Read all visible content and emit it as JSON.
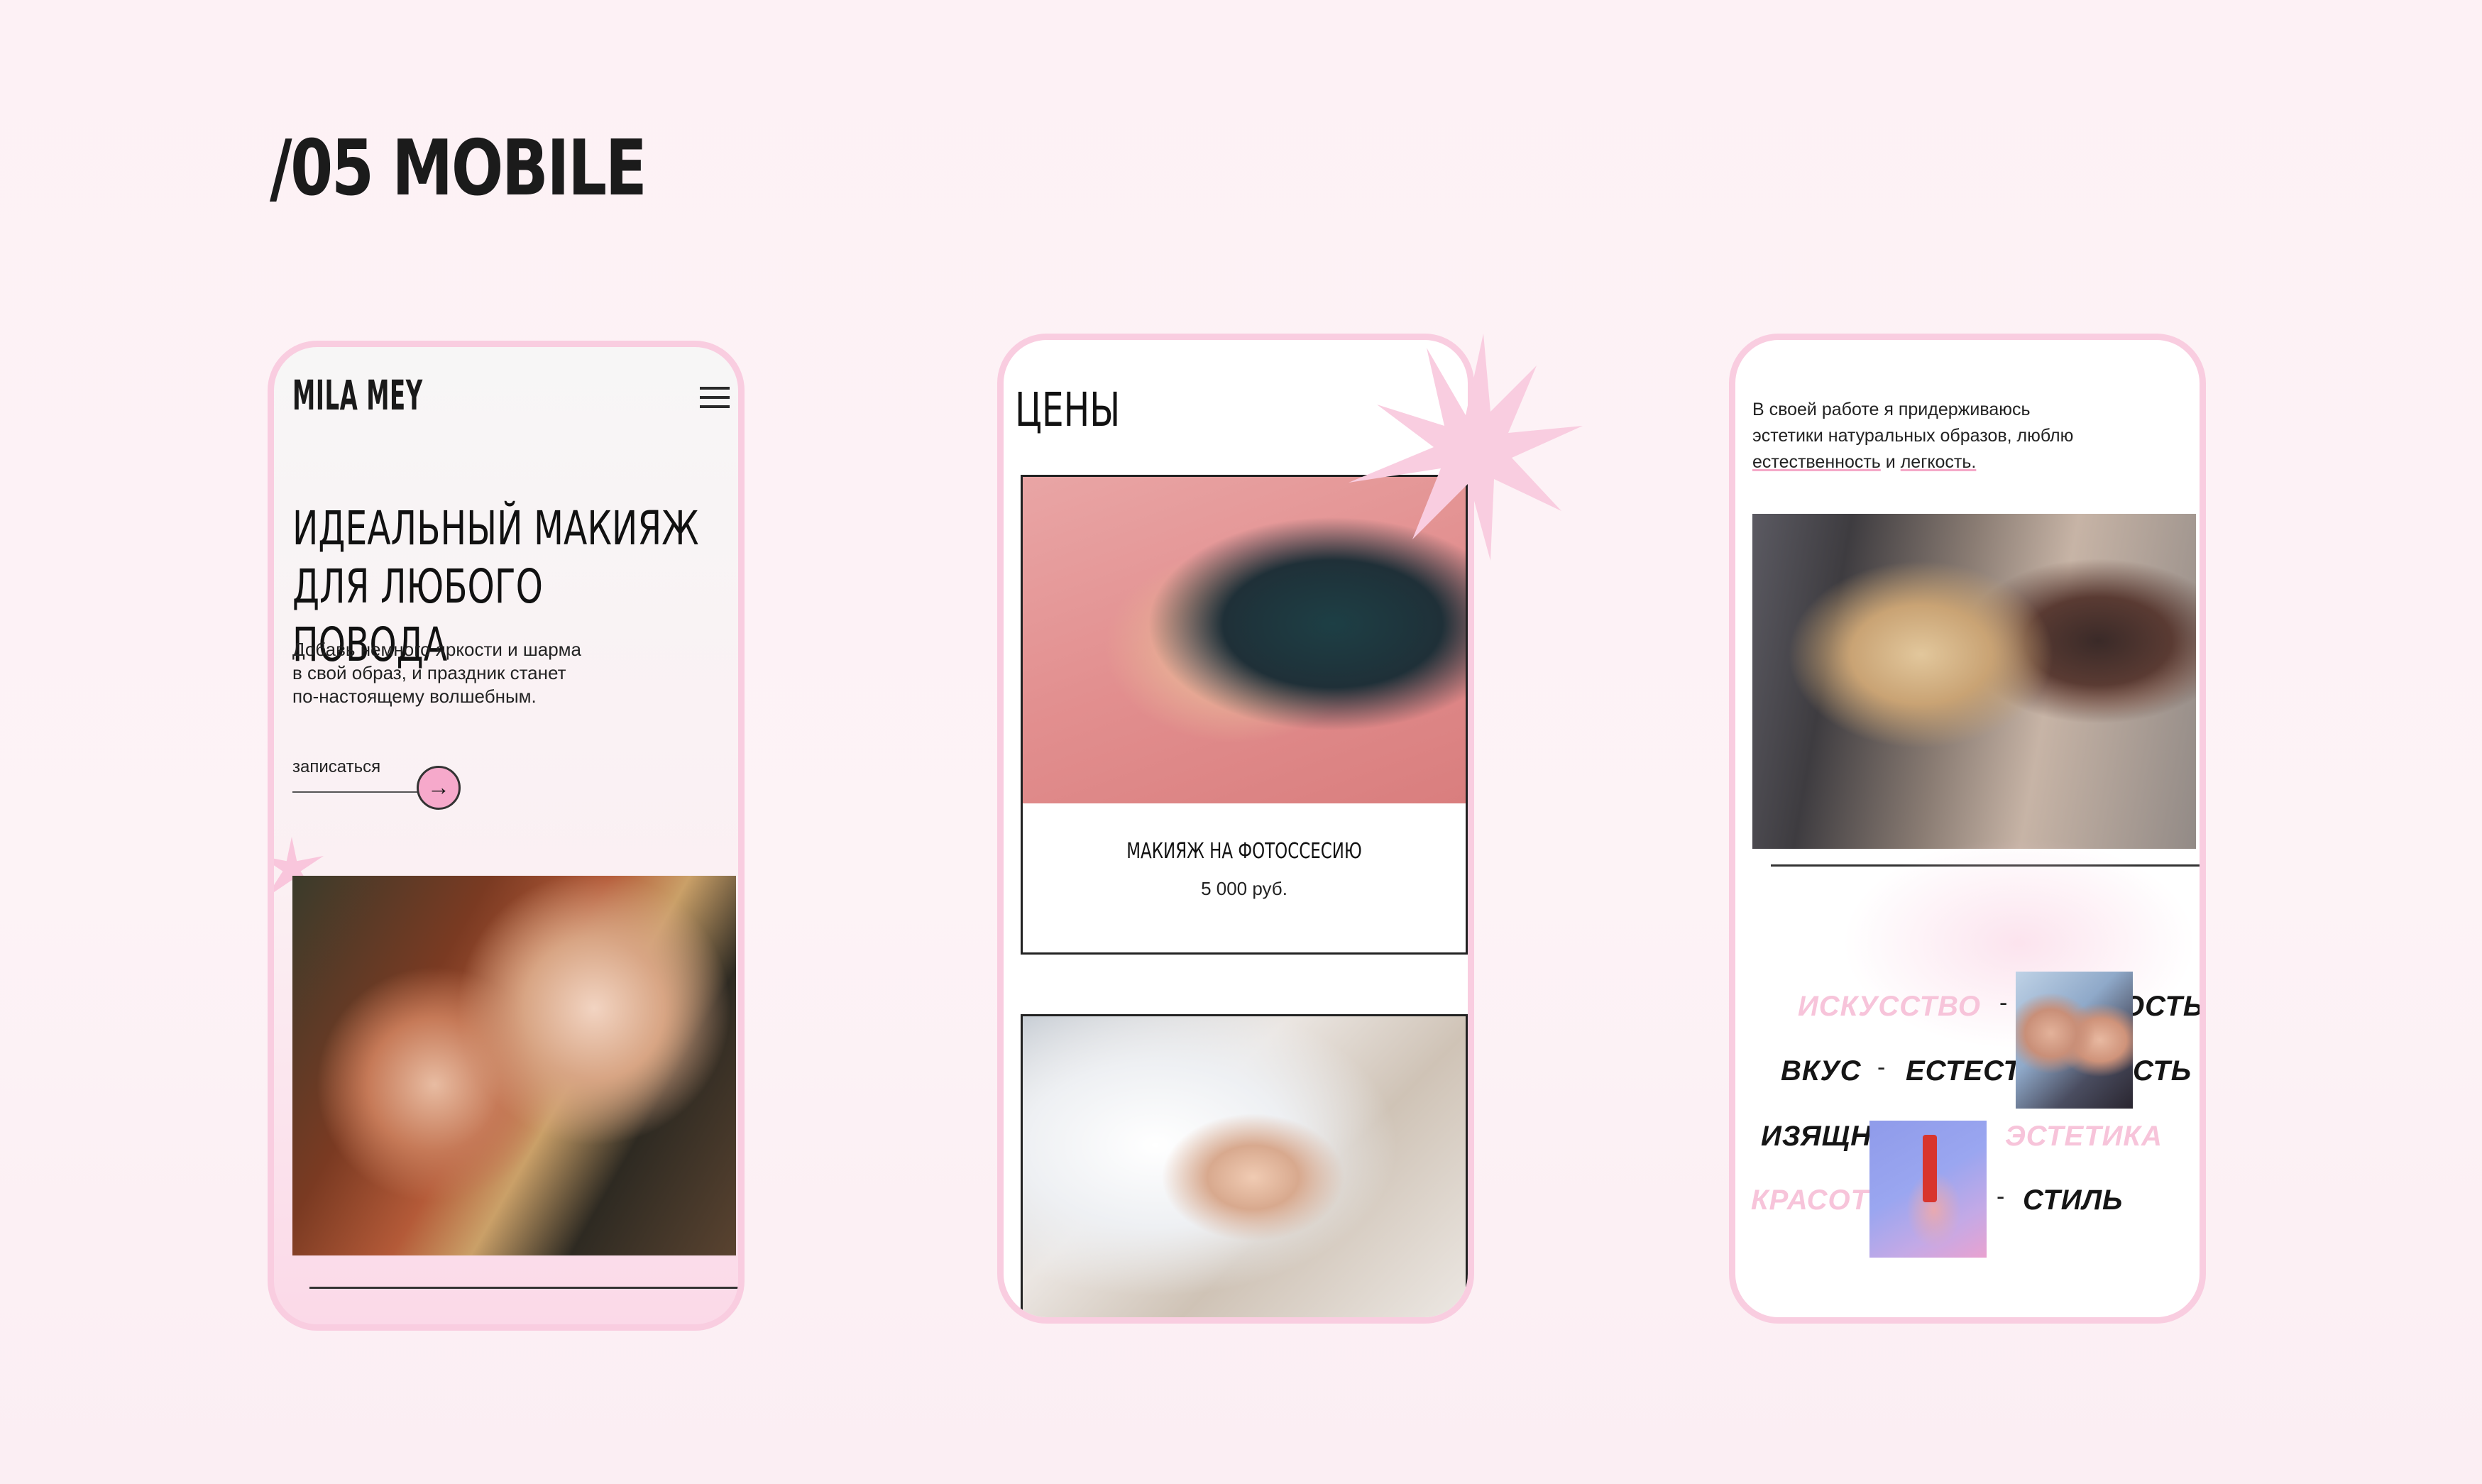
{
  "section": {
    "title": "/05 MOBILE"
  },
  "phone1": {
    "logo": "MILA MEY",
    "menu_icon": "hamburger-menu-icon",
    "hero_title_line1": "ИДЕАЛЬНЫЙ МАКИЯЖ",
    "hero_title_line2": "ДЛЯ ЛЮБОГО ПОВОДА",
    "hero_subtitle_line1": "Добавь немного яркости и шарма",
    "hero_subtitle_line2": "в свой образ, и праздник станет",
    "hero_subtitle_line3": "по-настоящему волшебным.",
    "cta_label": "записаться",
    "cta_icon": "arrow-right-icon",
    "photo": "two-women-portrait"
  },
  "phone2": {
    "title": "ЦЕНЫ",
    "card1": {
      "title": "МАКИЯЖ НА ФОТОССЕСИЮ",
      "price": "5 000 руб.",
      "photo": "woman-profile-makeup"
    },
    "card2": {
      "photo": "bride-with-veil"
    }
  },
  "phone3": {
    "about_line1": "В своей работе я придерживаюсь",
    "about_line2": "эстетики натуральных образов, люблю",
    "about_highlight1": "естественность",
    "about_and": "и",
    "about_highlight2": "легкость.",
    "photo": "makeup-artist-at-work",
    "words": {
      "w1": "ИСКУССТВО",
      "w2": "ОСТЬ",
      "w3": "ВКУС",
      "w4": "ЕСТЕСТ",
      "w5": "СТЬ",
      "w6": "ИЗЯЩН",
      "w7": "ЭСТЕТИКА",
      "w8": "КРАСОТ",
      "w9": "СТИЛЬ"
    },
    "dash": "-"
  },
  "colors": {
    "accent_pink": "#f7c4da",
    "frame_pink": "#f9cde0",
    "button_pink": "#f6a9cb"
  }
}
